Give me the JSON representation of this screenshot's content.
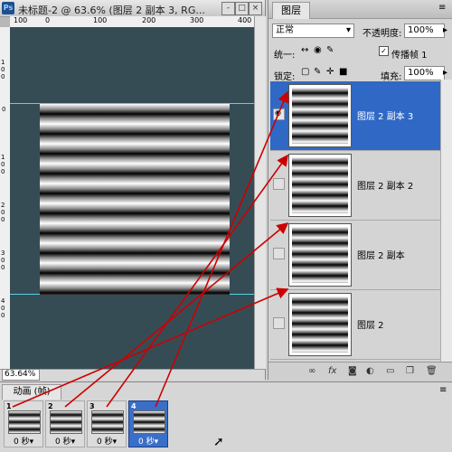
{
  "document": {
    "title": "未标题-2 @ 63.6% (图层 2 副本 3, RG...",
    "ps_icon": "Ps",
    "zoom": "63.64%",
    "ruler_top": [
      "100",
      "0",
      "100",
      "200",
      "300",
      "400"
    ],
    "ruler_left": [
      "1 0 0",
      "0",
      "1 0 0",
      "2 0 0",
      "3 0 0",
      "4 0 0"
    ],
    "buttons": {
      "minimize": "-",
      "maximize": "□",
      "close": "×"
    }
  },
  "layers_panel": {
    "tab_label": "图层",
    "blend_mode": "正常",
    "opacity_label": "不透明度:",
    "opacity_value": "100%",
    "unify_label": "统一:",
    "propagate_label": "传播帧 1",
    "lock_label": "锁定:",
    "fill_label": "填充:",
    "fill_value": "100%",
    "layers": [
      {
        "name": "图层 2 副本 3",
        "selected": true
      },
      {
        "name": "图层 2 副本 2",
        "selected": false
      },
      {
        "name": "图层 2 副本",
        "selected": false
      },
      {
        "name": "图层 2",
        "selected": false
      }
    ],
    "bottom_icons": [
      "link-icon",
      "fx-icon",
      "mask-icon",
      "adjustment-icon",
      "folder-icon",
      "new-layer-icon",
      "trash-icon"
    ]
  },
  "animation_panel": {
    "tab_label": "动画 (帧)",
    "frames": [
      {
        "number": "1",
        "delay": "0 秒▾",
        "selected": false
      },
      {
        "number": "2",
        "delay": "0 秒▾",
        "selected": false
      },
      {
        "number": "3",
        "delay": "0 秒▾",
        "selected": false
      },
      {
        "number": "4",
        "delay": "0 秒▾",
        "selected": true
      }
    ]
  },
  "colors": {
    "canvas_bg": "#364c55",
    "selection": "#3069c5",
    "arrow": "#cc0000"
  }
}
